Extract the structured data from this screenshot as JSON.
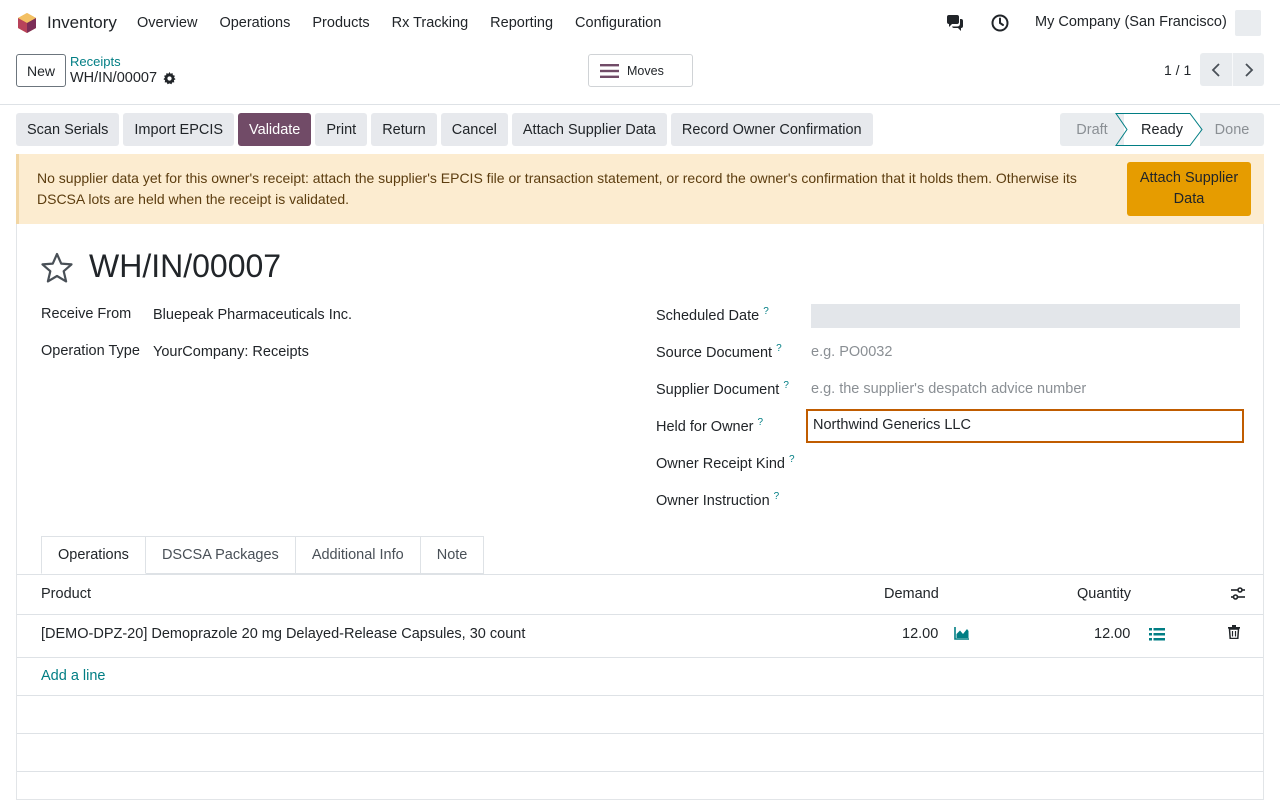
{
  "navbar": {
    "app_name": "Inventory",
    "menu": [
      "Overview",
      "Operations",
      "Products",
      "Rx Tracking",
      "Reporting",
      "Configuration"
    ],
    "company": "My Company (San Francisco)"
  },
  "control": {
    "new_label": "New",
    "breadcrumb_parent": "Receipts",
    "breadcrumb_current": "WH/IN/00007",
    "moves_label": "Moves",
    "pager": "1 / 1"
  },
  "actions": [
    "Scan Serials",
    "Import EPCIS",
    "Validate",
    "Print",
    "Return",
    "Cancel",
    "Attach Supplier Data",
    "Record Owner Confirmation"
  ],
  "status": {
    "steps": [
      "Draft",
      "Ready",
      "Done"
    ],
    "current": "Ready"
  },
  "alert": {
    "text": "No supplier data yet for this owner's receipt: attach the supplier's EPCIS file or transaction statement, or record the owner's confirmation that it holds them. Otherwise its DSCSA lots are held when the receipt is validated.",
    "button": "Attach Supplier Data"
  },
  "form": {
    "title": "WH/IN/00007",
    "receive_from_label": "Receive From",
    "receive_from": "Bluepeak Pharmaceuticals Inc.",
    "operation_type_label": "Operation Type",
    "operation_type": "YourCompany: Receipts",
    "scheduled_date_label": "Scheduled Date",
    "source_document_label": "Source Document",
    "source_document_placeholder": "e.g. PO0032",
    "supplier_document_label": "Supplier Document",
    "supplier_document_placeholder": "e.g. the supplier's despatch advice number",
    "held_for_owner_label": "Held for Owner",
    "held_for_owner": "Northwind Generics LLC",
    "owner_receipt_kind_label": "Owner Receipt Kind",
    "owner_instruction_label": "Owner Instruction",
    "help_mark": "?"
  },
  "tabs": [
    "Operations",
    "DSCSA Packages",
    "Additional Info",
    "Note"
  ],
  "table": {
    "headers": {
      "product": "Product",
      "demand": "Demand",
      "quantity": "Quantity"
    },
    "rows": [
      {
        "product": "[DEMO-DPZ-20] Demoprazole 20 mg Delayed-Release Capsules, 30 count",
        "demand": "12.00",
        "quantity": "12.00"
      }
    ],
    "add_line": "Add a line"
  },
  "colors": {
    "brand": "#714b67",
    "link": "#017e84",
    "alert_bg": "#fcecd0",
    "alert_button": "#e69c00",
    "focus_border": "#c05c00"
  }
}
